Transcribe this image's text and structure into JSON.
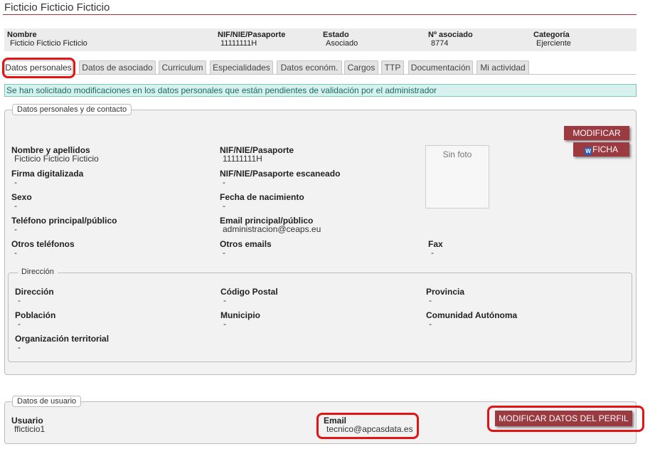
{
  "page": {
    "title": "Ficticio Ficticio Ficticio"
  },
  "summary": {
    "nombre": {
      "label": "Nombre",
      "value": "Ficticio Ficticio Ficticio"
    },
    "nif": {
      "label": "NIF/NIE/Pasaporte",
      "value": "11111111H"
    },
    "estado": {
      "label": "Estado",
      "value": "Asociado"
    },
    "asociado": {
      "label": "Nº asociado",
      "value": "8774"
    },
    "categoria": {
      "label": "Categoría",
      "value": "Ejerciente"
    }
  },
  "tabs": [
    {
      "label": "Datos personales"
    },
    {
      "label": "Datos de asociado"
    },
    {
      "label": "Curriculum"
    },
    {
      "label": "Especialidades"
    },
    {
      "label": "Datos económ."
    },
    {
      "label": "Cargos"
    },
    {
      "label": "TTP"
    },
    {
      "label": "Documentación"
    },
    {
      "label": "Mi actividad"
    }
  ],
  "notice": "Se han solicitado modificaciones en los datos personales que están pendientes de validación por el administrador",
  "personal": {
    "legend": "Datos personales y de contacto",
    "modify_button": "MODIFICAR",
    "ficha_button": "FICHA",
    "photo_text": "Sin foto",
    "fields": {
      "nombre": {
        "label": "Nombre y apellidos",
        "value": "Ficticio Ficticio Ficticio"
      },
      "nif": {
        "label": "NIF/NIE/Pasaporte",
        "value": "11111111H"
      },
      "firma": {
        "label": "Firma digitalizada",
        "value": "-"
      },
      "nif_scan": {
        "label": "NIF/NIE/Pasaporte escaneado",
        "value": "-"
      },
      "sexo": {
        "label": "Sexo",
        "value": "-"
      },
      "nacimiento": {
        "label": "Fecha de nacimiento",
        "value": "-"
      },
      "telefono": {
        "label": "Teléfono principal/público",
        "value": "-"
      },
      "email": {
        "label": "Email principal/público",
        "value": "administracion@ceaps.eu"
      },
      "otros_tel": {
        "label": "Otros teléfonos",
        "value": "-"
      },
      "otros_email": {
        "label": "Otros emails",
        "value": "-"
      },
      "fax": {
        "label": "Fax",
        "value": "-"
      }
    },
    "address": {
      "legend": "Dirección",
      "direccion": {
        "label": "Dirección",
        "value": "-"
      },
      "cp": {
        "label": "Código Postal",
        "value": "-"
      },
      "provincia": {
        "label": "Provincia",
        "value": "-"
      },
      "poblacion": {
        "label": "Población",
        "value": "-"
      },
      "municipio": {
        "label": "Municipio",
        "value": "-"
      },
      "comunidad": {
        "label": "Comunidad Autónoma",
        "value": "-"
      },
      "organizacion": {
        "label": "Organización territorial",
        "value": "-"
      }
    }
  },
  "user": {
    "legend": "Datos de usuario",
    "usuario": {
      "label": "Usuario",
      "value": "fficticio1"
    },
    "email": {
      "label": "Email",
      "value": "tecnico@apcasdata.es"
    },
    "modify_profile_button": "MODIFICAR DATOS DEL PERFIL"
  },
  "colors": {
    "accent": "#9c3a42",
    "highlight": "#e01515",
    "notice_bg": "#d6f1ee"
  },
  "icons": {
    "ficha": "word-document-icon"
  }
}
